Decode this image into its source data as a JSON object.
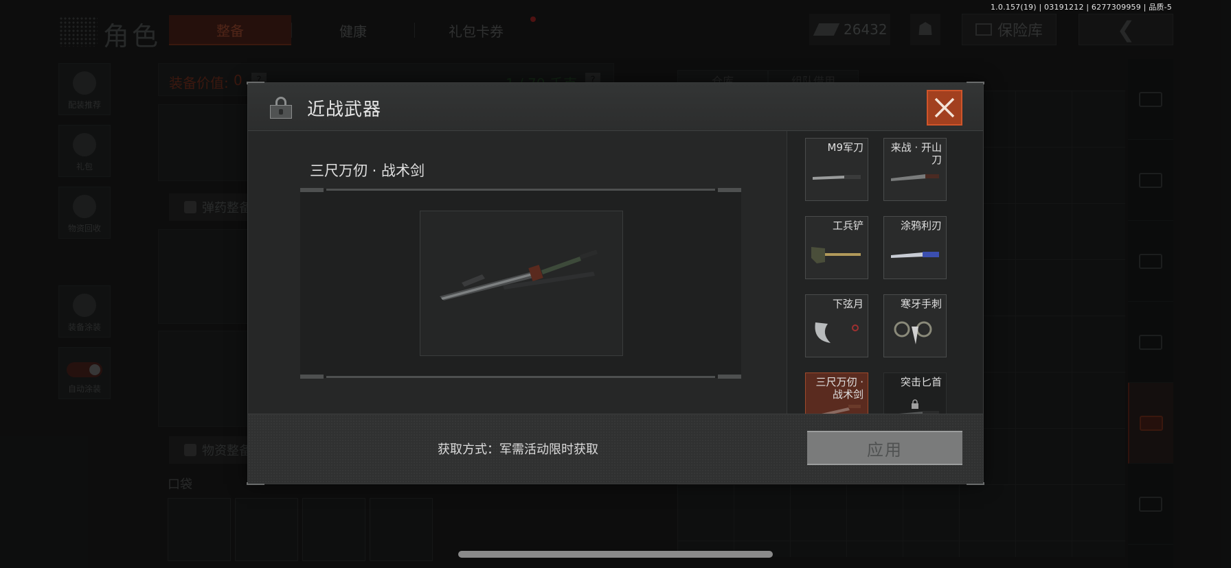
{
  "status": {
    "version": "1.0.157(19) | 03191212 | 6277309959 | 品质-5"
  },
  "background": {
    "title": "角色",
    "tabs": [
      {
        "label": "整备",
        "active": true
      },
      {
        "label": "健康",
        "active": false
      },
      {
        "label": "礼包卡券",
        "active": false
      }
    ],
    "currency": {
      "value": "26432"
    },
    "vault_label": "保险库",
    "back_icon": "chevron-left-icon",
    "sidebar": [
      {
        "label": "配装推荐"
      },
      {
        "label": "礼包"
      },
      {
        "label": "物资回收"
      },
      {
        "label": "装备涂装"
      },
      {
        "label": "自动涂装"
      }
    ],
    "equip_value_label": "装备价值:",
    "equip_value": "0",
    "weight_text": "1 / 70 千克",
    "ammo_label": "弹药整备",
    "supply_label": "物资整备",
    "pocket_label": "口袋",
    "warehouse_tabs": [
      "仓库",
      "组队借用"
    ]
  },
  "modal": {
    "title": "近战武器",
    "selected_weapon": "三尺万仞 · 战术剑",
    "acquire_label": "获取方式：军需活动限时获取",
    "apply_label": "应用",
    "accent_color": "#a2401f",
    "weapons": [
      {
        "name": "M9军刀",
        "state": "normal"
      },
      {
        "name": "来战 · 开山刀",
        "state": "normal"
      },
      {
        "name": "工兵铲",
        "state": "normal"
      },
      {
        "name": "涂鸦利刃",
        "state": "normal"
      },
      {
        "name": "下弦月",
        "state": "normal"
      },
      {
        "name": "寒牙手刺",
        "state": "normal"
      },
      {
        "name": "三尺万仞 · 战术剑",
        "state": "selected"
      },
      {
        "name": "突击匕首",
        "state": "locked"
      }
    ]
  }
}
